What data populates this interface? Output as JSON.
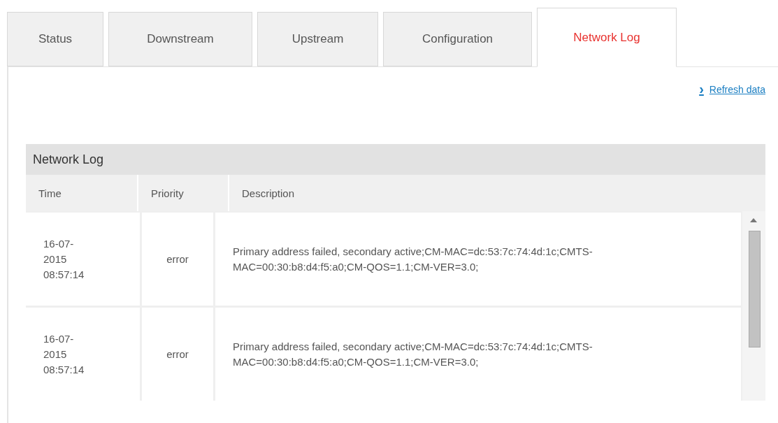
{
  "tabs": [
    {
      "label": "Status",
      "selected": false
    },
    {
      "label": "Downstream",
      "selected": false
    },
    {
      "label": "Upstream",
      "selected": false
    },
    {
      "label": "Configuration",
      "selected": false
    },
    {
      "label": "Network Log",
      "selected": true
    }
  ],
  "refresh_link": {
    "icon": "›",
    "label": "Refresh data"
  },
  "table": {
    "title": "Network Log",
    "columns": [
      "Time",
      "Priority",
      "Description"
    ],
    "rows": [
      {
        "time": "16-07-\n2015\n08:57:14",
        "priority": "error",
        "description": "Primary address failed, secondary active;CM-MAC=dc:53:7c:74:4d:1c;CMTS-MAC=00:30:b8:d4:f5:a0;CM-QOS=1.1;CM-VER=3.0;"
      },
      {
        "time": "16-07-\n2015\n08:57:14",
        "priority": "error",
        "description": "Primary address failed, secondary active;CM-MAC=dc:53:7c:74:4d:1c;CMTS-MAC=00:30:b8:d4:f5:a0;CM-QOS=1.1;CM-VER=3.0;"
      }
    ]
  }
}
